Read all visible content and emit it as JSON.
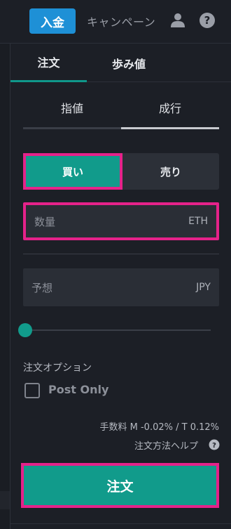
{
  "header": {
    "deposit_label": "入金",
    "campaign_label": "キャンペーン",
    "user_icon": "user-icon",
    "help_icon": "help-icon"
  },
  "tabs": [
    {
      "label": "注文",
      "active": true
    },
    {
      "label": "歩み値",
      "active": false
    }
  ],
  "order_type_tabs": [
    {
      "label": "指値",
      "active": false
    },
    {
      "label": "成行",
      "active": true
    }
  ],
  "side": {
    "buy_label": "買い",
    "sell_label": "売り",
    "selected": "buy"
  },
  "quantity_field": {
    "placeholder": "数量",
    "unit": "ETH"
  },
  "estimate_field": {
    "placeholder": "予想",
    "unit": "JPY"
  },
  "slider": {
    "value": 0
  },
  "options": {
    "label": "注文オプション",
    "post_only_label": "Post Only",
    "post_only_checked": false
  },
  "fee_text": "手数料 M -0.02% / T 0.12%",
  "help_link": "注文方法ヘルプ",
  "submit_label": "注文",
  "colors": {
    "accent_teal": "#119b8b",
    "deposit_blue": "#1e90d6",
    "highlight_pink": "#e5228a",
    "background": "#1c1f26"
  }
}
